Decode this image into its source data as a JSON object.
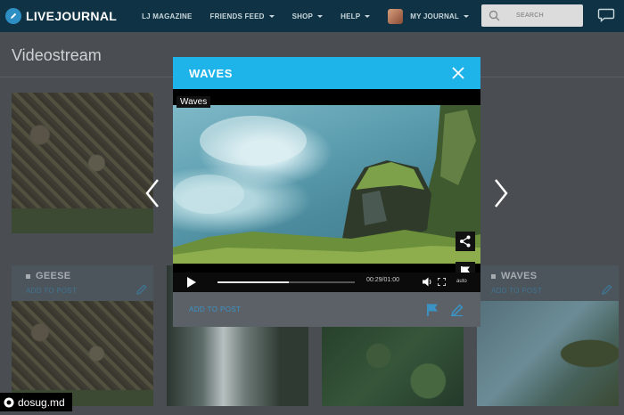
{
  "header": {
    "logo_text": "LIVEJOURNAL",
    "nav": [
      {
        "label": "LJ MAGAZINE",
        "has_menu": false
      },
      {
        "label": "FRIENDS FEED",
        "has_menu": true
      },
      {
        "label": "SHOP",
        "has_menu": true
      },
      {
        "label": "HELP",
        "has_menu": true
      }
    ],
    "my_journal_label": "MY JOURNAL",
    "search_placeholder": "SEARCH"
  },
  "page": {
    "title": "Videostream"
  },
  "cards": [
    {
      "title": "GEESE",
      "link": "ADD TO POST"
    },
    {
      "title": "WAVES",
      "link": "ADD TO POST"
    }
  ],
  "modal": {
    "title": "WAVES",
    "video_label": "Waves",
    "player": {
      "time": "00:29/01:00",
      "progress": 0.52,
      "quality": "auto"
    },
    "footer_link": "ADD TO POST"
  },
  "watermark": {
    "text": "dosug.md"
  },
  "colors": {
    "nav_bg": "#0f3344",
    "modal_accent": "#1fb4e9",
    "link": "#3b92c4"
  }
}
